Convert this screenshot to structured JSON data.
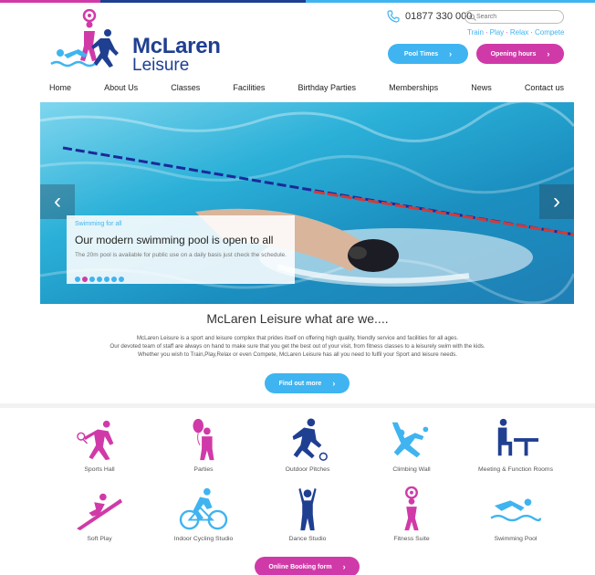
{
  "colors": {
    "brand_blue": "#1f3f91",
    "accent_cyan": "#3fb4f0",
    "accent_magenta": "#d03aa8"
  },
  "header": {
    "logo_line1": "McLaren",
    "logo_line2": "Leisure",
    "phone": "01877 330 000",
    "search_placeholder": "Search",
    "tagline": [
      "Train",
      "Play",
      "Relax",
      "Compete"
    ],
    "pool_times_label": "Pool Times",
    "opening_hours_label": "Opening hours"
  },
  "nav": [
    "Home",
    "About Us",
    "Classes",
    "Facilities",
    "Birthday Parties",
    "Memberships",
    "News",
    "Contact us"
  ],
  "hero": {
    "kicker": "Swimming for all",
    "title": "Our modern swimming pool is open to all",
    "description": "The 20m pool is available for public use on a daily basis just check the schedule.",
    "slide_count": 7,
    "active_slide": 1
  },
  "about": {
    "title": "McLaren Leisure what are we....",
    "lines": [
      "McLaren Leisure is a sport and leisure complex that prides itself on offering high quality, friendly service and facilities for all ages.",
      "Our devoted team of staff are always on hand to make sure that you get the best out of your visit, from fitness classes to a leisurely swim with the kids.",
      "Whether you wish to Train,Play,Relax or even Compete, McLaren Leisure has all you need to fulfil your Sport and leisure needs."
    ],
    "find_out_more_label": "Find out more"
  },
  "facilities": [
    {
      "label": "Sports Hall",
      "icon": "badminton-player-icon",
      "color": "#d03aa8"
    },
    {
      "label": "Parties",
      "icon": "balloon-figure-icon",
      "color": "#d03aa8"
    },
    {
      "label": "Outdoor Pitches",
      "icon": "football-player-icon",
      "color": "#1f3f91"
    },
    {
      "label": "Climbing Wall",
      "icon": "climber-icon",
      "color": "#3fb4f0"
    },
    {
      "label": "Meeting & Function Rooms",
      "icon": "meeting-table-icon",
      "color": "#1f3f91"
    },
    {
      "label": "Soft Play",
      "icon": "slide-figure-icon",
      "color": "#d03aa8"
    },
    {
      "label": "Indoor Cycling Studio",
      "icon": "cyclist-icon",
      "color": "#3fb4f0"
    },
    {
      "label": "Dance Studio",
      "icon": "dancer-icon",
      "color": "#1f3f91"
    },
    {
      "label": "Fitness Suite",
      "icon": "weightlifter-icon",
      "color": "#d03aa8"
    },
    {
      "label": "Swimming Pool",
      "icon": "swimmer-icon",
      "color": "#3fb4f0"
    }
  ],
  "booking_label": "Online Booking form"
}
